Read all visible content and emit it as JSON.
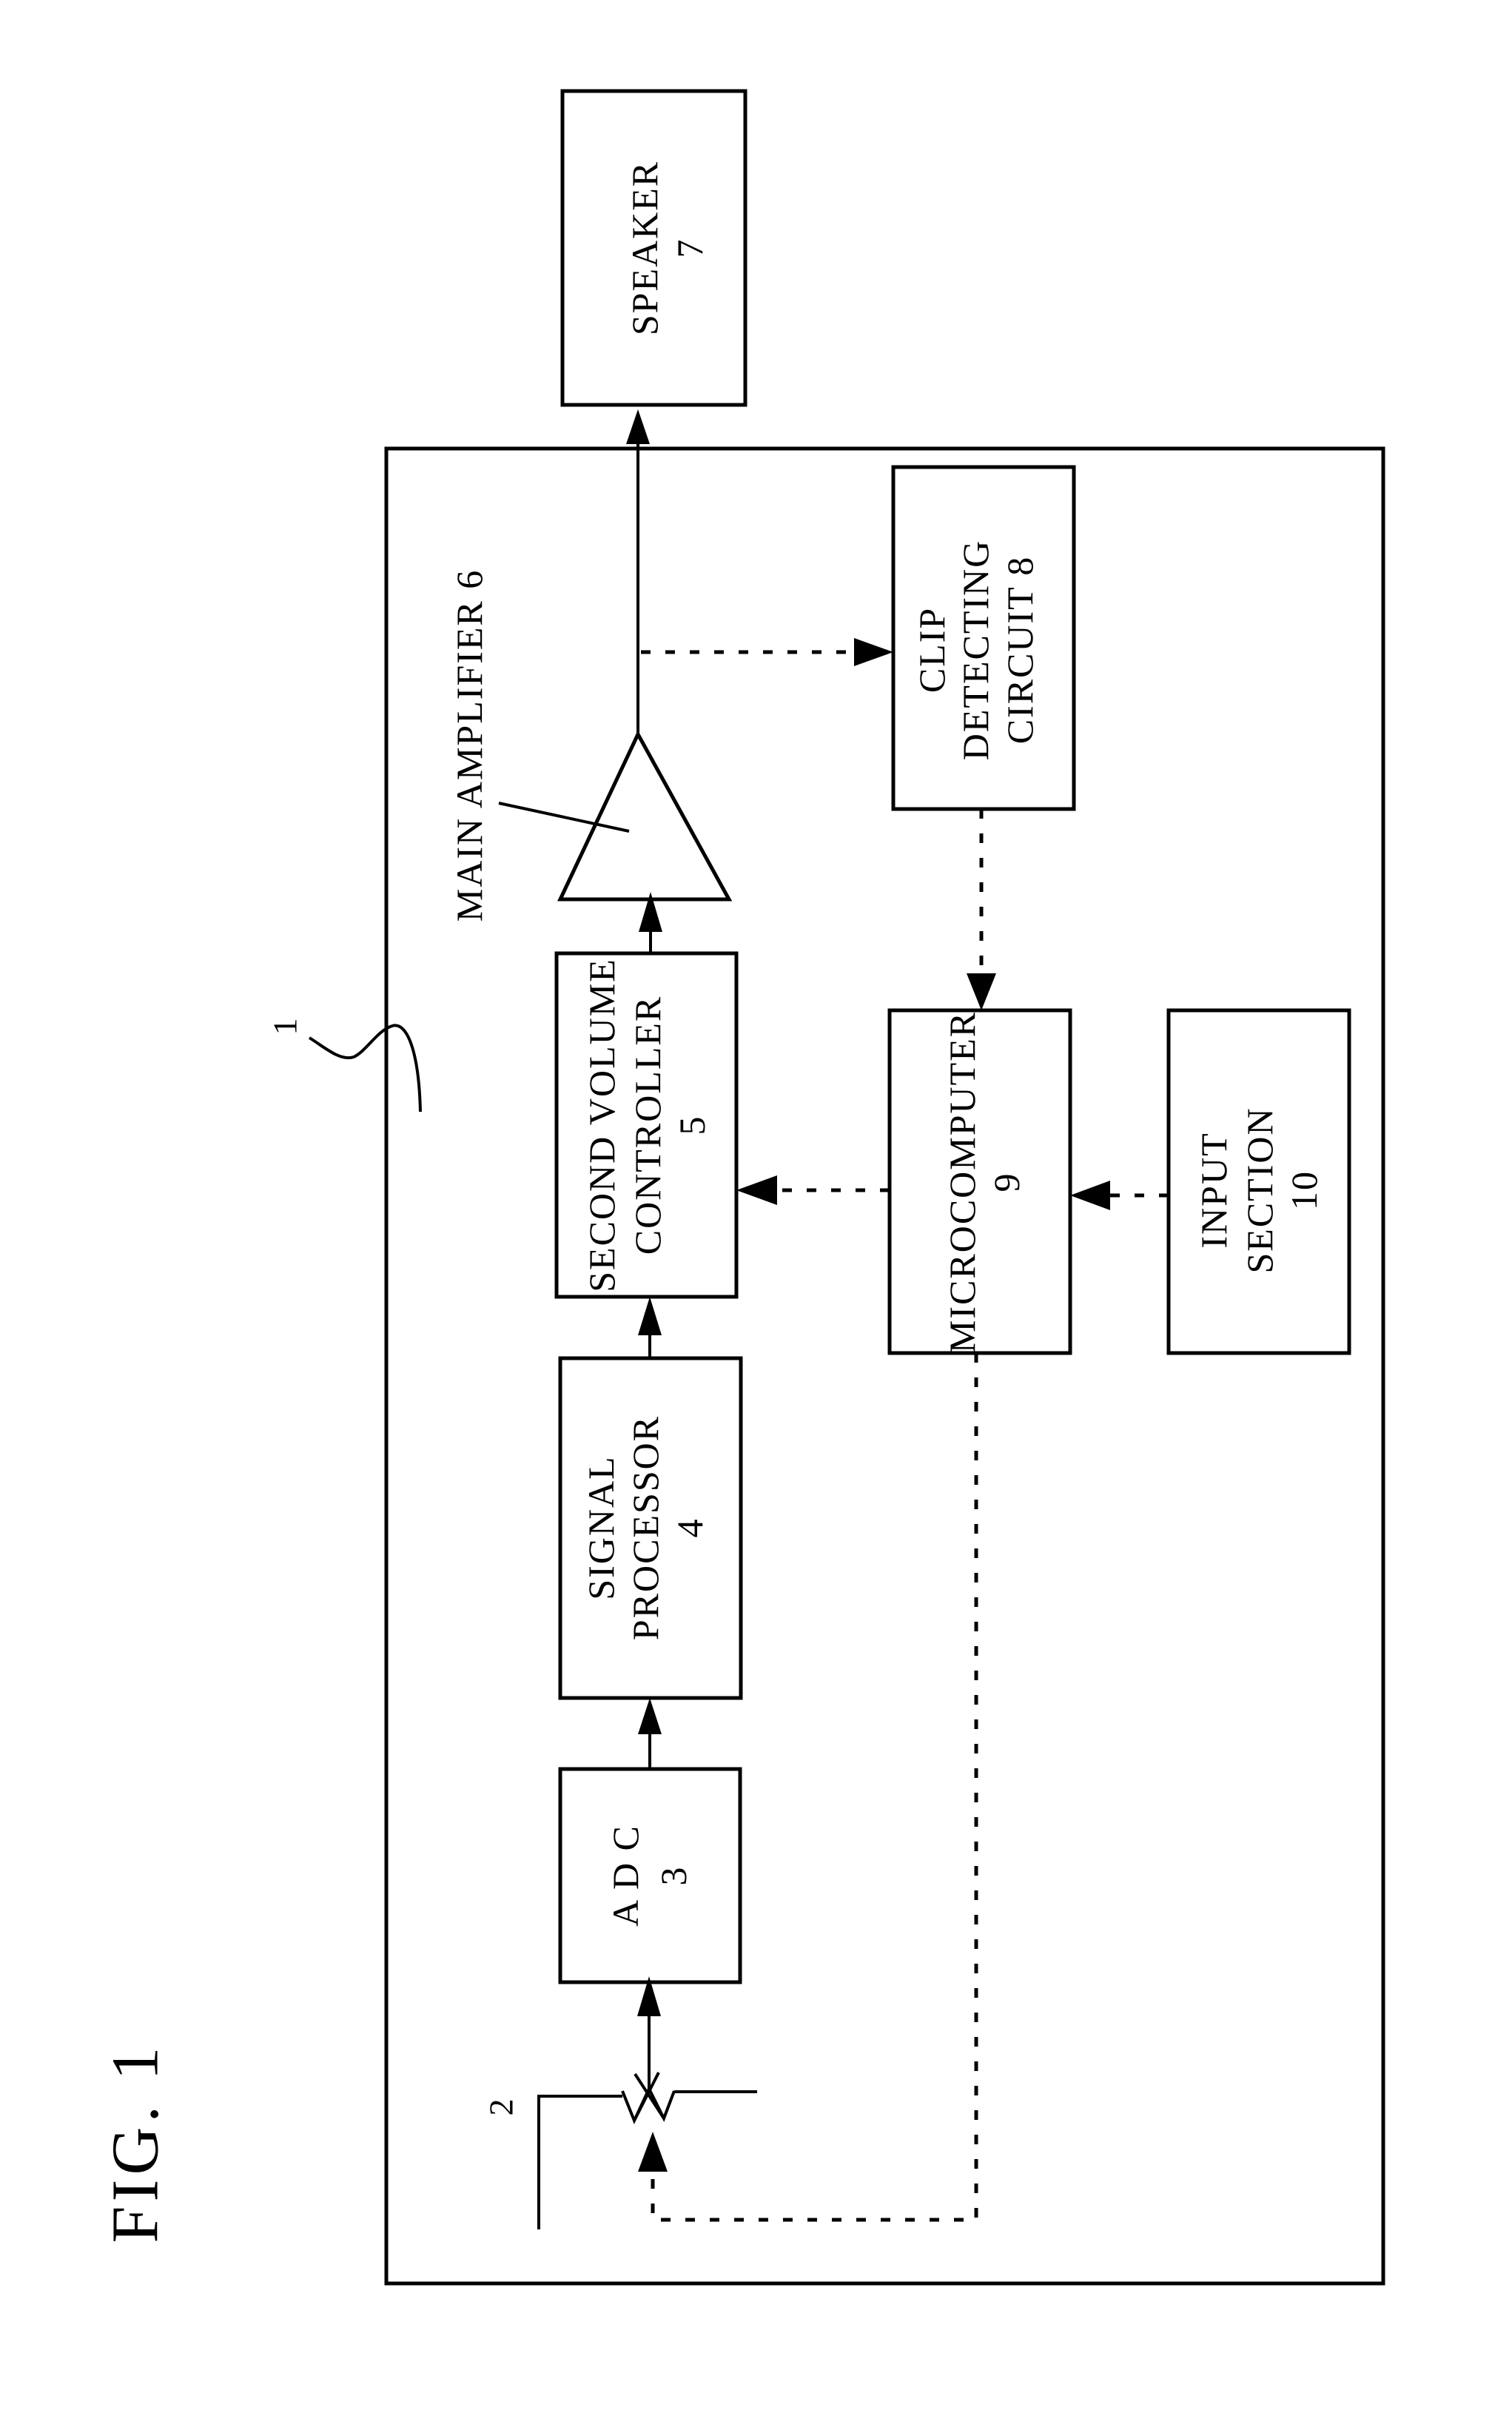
{
  "figure": {
    "title": "FIG. 1",
    "device_ref": "1",
    "volume_ref": "2"
  },
  "blocks": {
    "speaker": {
      "lines": [
        "SPEAKER",
        "7"
      ]
    },
    "clip_detecting_circuit": {
      "lines": [
        "CLIP",
        "DETECTING",
        "CIRCUIT 8"
      ]
    },
    "main_amplifier": {
      "label": "MAIN AMPLIFIER 6"
    },
    "second_volume_controller": {
      "lines": [
        "SECOND VOLUME",
        "CONTROLLER",
        "5"
      ]
    },
    "microcomputer": {
      "lines": [
        "MICROCOMPUTER",
        "9"
      ]
    },
    "input_section": {
      "lines": [
        "INPUT",
        "SECTION",
        "10"
      ]
    },
    "signal_processor": {
      "lines": [
        "SIGNAL",
        "PROCESSOR",
        "4"
      ]
    },
    "adc": {
      "lines": [
        "A D C",
        "3"
      ]
    }
  },
  "connections": [
    {
      "from": "volume_2",
      "to": "adc",
      "style": "solid"
    },
    {
      "from": "adc",
      "to": "signal_processor",
      "style": "solid"
    },
    {
      "from": "signal_processor",
      "to": "second_volume_controller",
      "style": "solid"
    },
    {
      "from": "second_volume_controller",
      "to": "main_amplifier",
      "style": "solid"
    },
    {
      "from": "main_amplifier",
      "to": "speaker",
      "style": "solid"
    },
    {
      "from": "main_amplifier",
      "to": "clip_detecting_circuit",
      "style": "dashed"
    },
    {
      "from": "clip_detecting_circuit",
      "to": "microcomputer",
      "style": "dashed"
    },
    {
      "from": "microcomputer",
      "to": "second_volume_controller",
      "style": "dashed"
    },
    {
      "from": "input_section",
      "to": "microcomputer",
      "style": "dashed"
    },
    {
      "from": "microcomputer",
      "to": "volume_2",
      "style": "dashed"
    }
  ]
}
